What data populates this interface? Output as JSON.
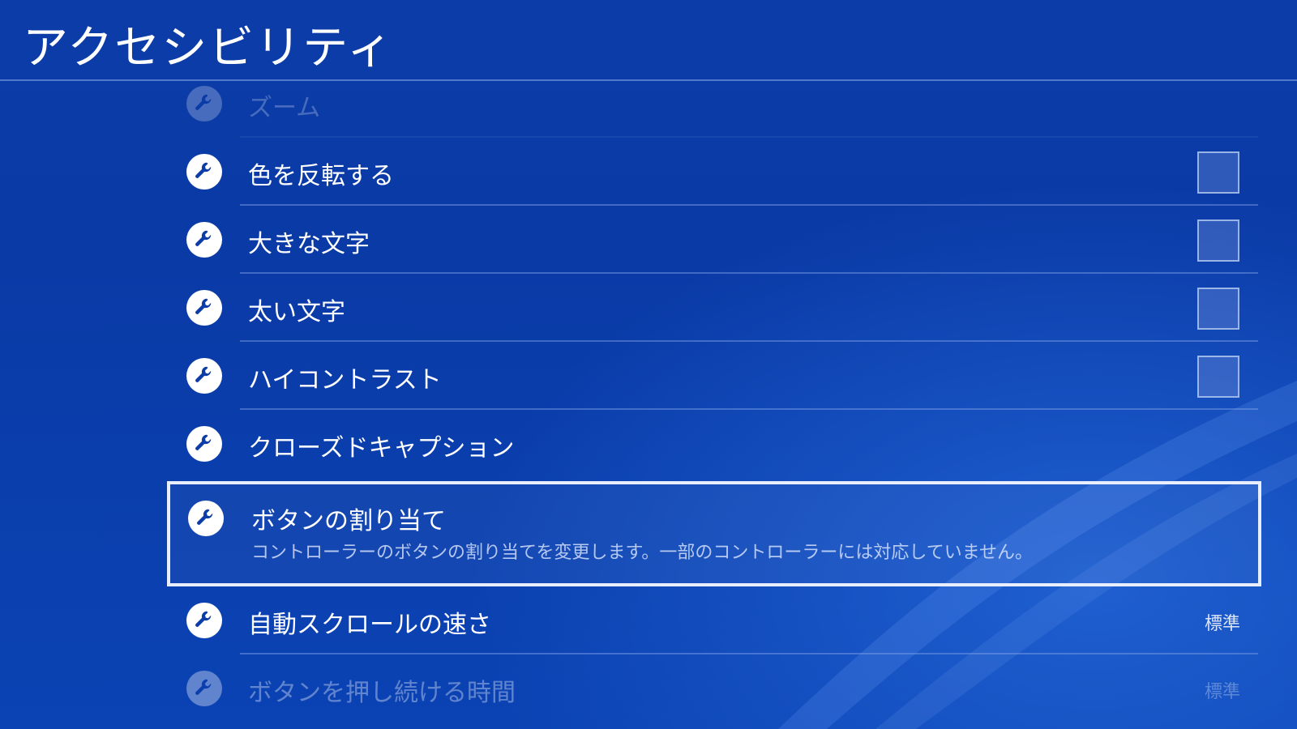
{
  "title": "アクセシビリティ",
  "items": [
    {
      "label": "ズーム"
    },
    {
      "label": "色を反転する"
    },
    {
      "label": "大きな文字"
    },
    {
      "label": "太い文字"
    },
    {
      "label": "ハイコントラスト"
    },
    {
      "label": "クローズドキャプション"
    },
    {
      "label": "ボタンの割り当て",
      "description": "コントローラーのボタンの割り当てを変更します。一部のコントローラーには対応していません。"
    },
    {
      "label": "自動スクロールの速さ",
      "value": "標準"
    },
    {
      "label": "ボタンを押し続ける時間",
      "value": "標準"
    }
  ]
}
